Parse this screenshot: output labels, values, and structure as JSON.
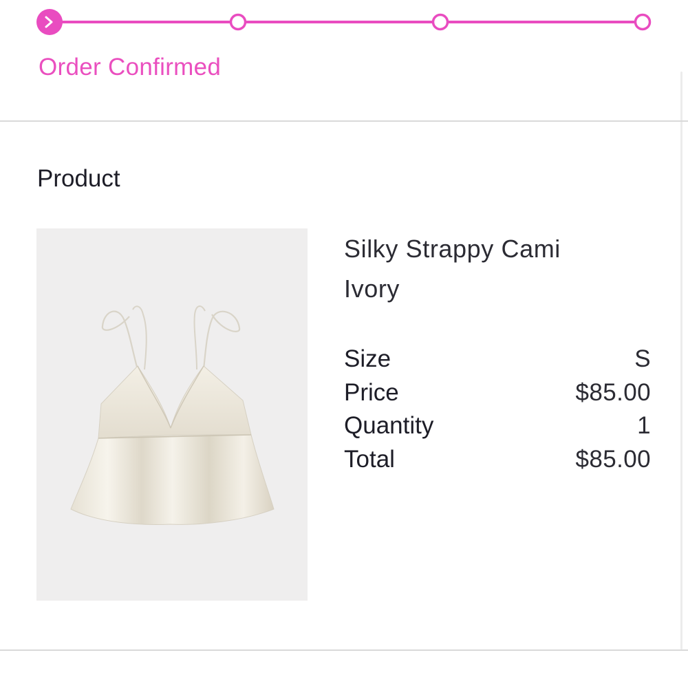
{
  "order_status": {
    "current_label": "Order Confirmed",
    "steps_total": 4,
    "current_step": 1,
    "accent_color": "#e94cc0"
  },
  "product_section": {
    "title": "Product",
    "image_icon": "silky-cami-product-photo",
    "name": "Silky Strappy Cami",
    "color": "Ivory",
    "details": [
      {
        "label": "Size",
        "value": "S"
      },
      {
        "label": "Price",
        "value": "$85.00"
      },
      {
        "label": "Quantity",
        "value": "1"
      },
      {
        "label": "Total",
        "value": "$85.00"
      }
    ]
  }
}
